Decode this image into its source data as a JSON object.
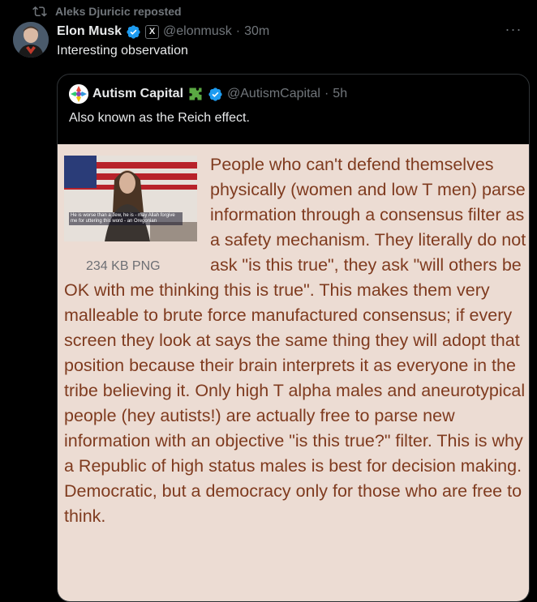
{
  "repost": {
    "label": "Aleks Djuricic reposted",
    "icon": "repost-icon"
  },
  "author": {
    "name": "Elon Musk",
    "badge_letter": "X",
    "handle": "@elonmusk",
    "separator": "·",
    "time": "30m",
    "more": "···"
  },
  "tweet": {
    "text": "Interesting observation"
  },
  "quote": {
    "name": "Autism Capital",
    "handle": "@AutismCapital",
    "separator": "·",
    "time": "5h",
    "text": "Also known as the Reich effect."
  },
  "image": {
    "thumb_caption": "He is worse than a Jew, he is - may Allah forgive me for uttering this word - an Oregonian",
    "size_label": "234 KB PNG",
    "body": "People who can't defend themselves physically (women and low T men) parse information through a consensus filter as a safety mechanism. They literally do not ask \"is this true\", they ask \"will others be OK with me thinking this is true\". This makes them very malleable to brute force manufactured consensus; if every screen they look at says the same thing they will adopt that position because their brain interprets it as everyone in the tribe believing it. Only high T alpha males and aneurotypical people (hey autists!) are actually free to parse new information with an objective \"is this true?\" filter. This is why a Republic of high status males is best for decision making. Democratic, but a democracy only for those who are free to think."
  },
  "colors": {
    "background": "#000000",
    "text": "#e7e9ea",
    "muted": "#71767b",
    "verified": "#1d9bf0",
    "image_bg": "#ecdcd3",
    "image_text": "#7f3b1f"
  }
}
